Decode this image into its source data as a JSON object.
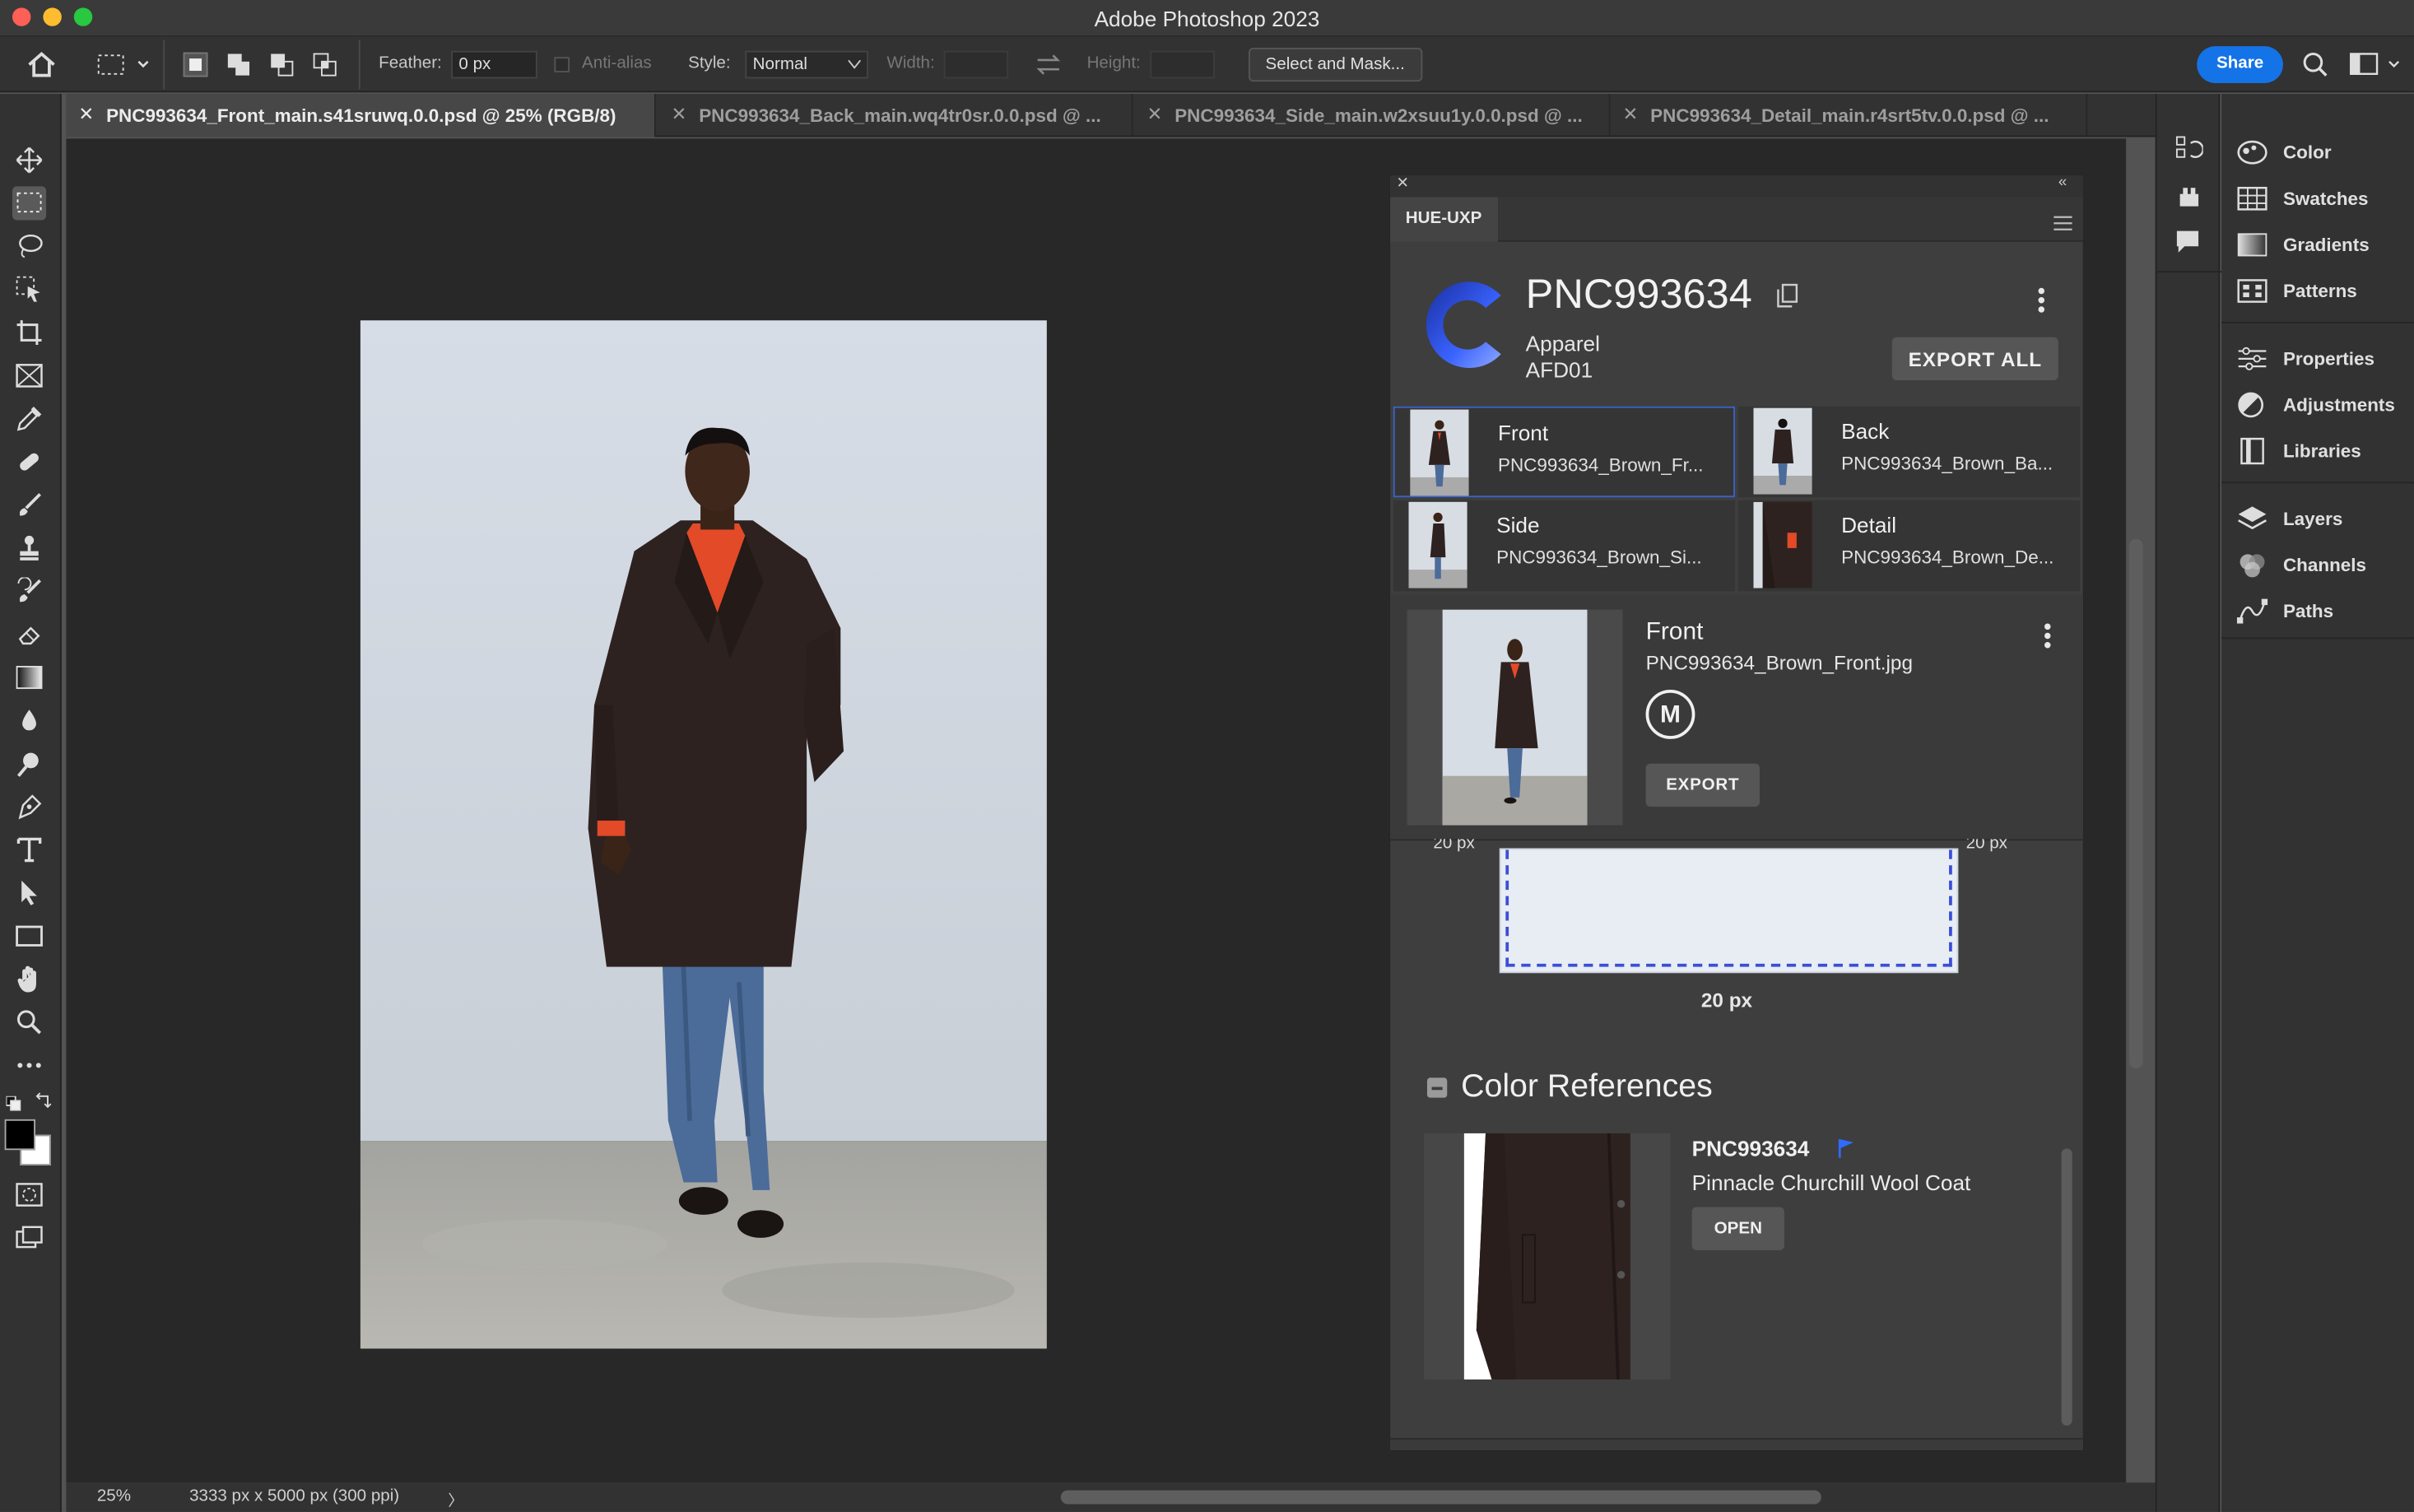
{
  "app": {
    "title": "Adobe Photoshop 2023"
  },
  "options": {
    "feather_label": "Feather:",
    "feather_value": "0 px",
    "antialias_label": "Anti-alias",
    "style_label": "Style:",
    "style_value": "Normal",
    "width_label": "Width:",
    "height_label": "Height:",
    "select_mask": "Select and Mask...",
    "share": "Share"
  },
  "tabs": [
    {
      "label": "PNC993634_Front_main.s41sruwq.0.0.psd @ 25% (RGB/8)"
    },
    {
      "label": "PNC993634_Back_main.wq4tr0sr.0.0.psd @ ..."
    },
    {
      "label": "PNC993634_Side_main.w2xsuu1y.0.0.psd @ ..."
    },
    {
      "label": "PNC993634_Detail_main.r4srt5tv.0.0.psd @ ..."
    }
  ],
  "status": {
    "zoom": "25%",
    "doc_info": "3333 px x 5000 px (300 ppi)",
    "arrow": "〉"
  },
  "panel": {
    "tab": "HUE-UXP",
    "product_id": "PNC993634",
    "category": "Apparel",
    "code": "AFD01",
    "export_all": "EXPORT ALL",
    "views": [
      {
        "name": "Front",
        "file": "PNC993634_Brown_Fr..."
      },
      {
        "name": "Back",
        "file": "PNC993634_Brown_Ba..."
      },
      {
        "name": "Side",
        "file": "PNC993634_Brown_Si..."
      },
      {
        "name": "Detail",
        "file": "PNC993634_Brown_De..."
      }
    ],
    "selected": {
      "name": "Front",
      "file": "PNC993634_Brown_Front.jpg",
      "badge": "M",
      "export": "EXPORT"
    },
    "margin_left": "20 px",
    "margin_right": "20 px",
    "margin_bottom": "20 px",
    "color_refs_title": "Color References",
    "color_ref": {
      "id": "PNC993634",
      "name": "Pinnacle Churchill Wool Coat",
      "open": "OPEN"
    }
  },
  "dock": {
    "group1": [
      {
        "label": "Color",
        "icon": "color-wheel-icon"
      },
      {
        "label": "Swatches",
        "icon": "swatches-icon"
      },
      {
        "label": "Gradients",
        "icon": "gradient-icon"
      },
      {
        "label": "Patterns",
        "icon": "patterns-icon"
      }
    ],
    "group2": [
      {
        "label": "Properties",
        "icon": "sliders-icon"
      },
      {
        "label": "Adjustments",
        "icon": "adjustments-icon"
      },
      {
        "label": "Libraries",
        "icon": "libraries-icon"
      }
    ],
    "group3": [
      {
        "label": "Layers",
        "icon": "layers-icon"
      },
      {
        "label": "Channels",
        "icon": "channels-icon"
      },
      {
        "label": "Paths",
        "icon": "paths-icon"
      }
    ]
  },
  "colors": {
    "accent": "#1473e6",
    "flag": "#2f6bff",
    "selection_border": "#3a63c8"
  }
}
